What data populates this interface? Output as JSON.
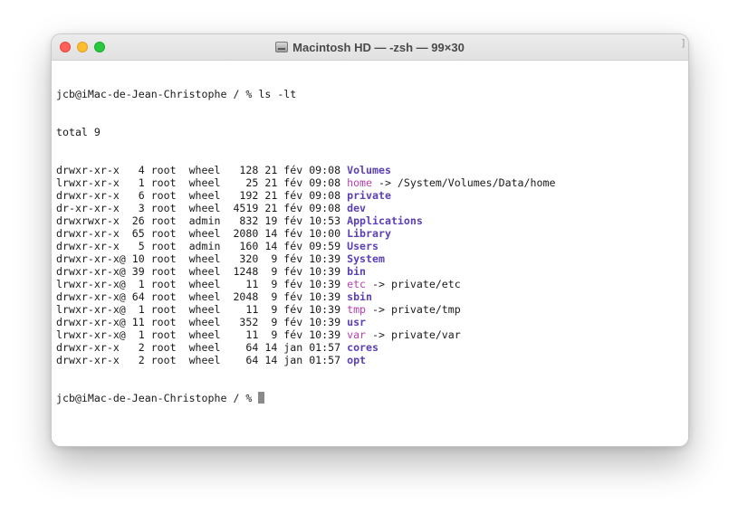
{
  "window": {
    "title": "Macintosh HD — -zsh — 99×30",
    "scroll_mark": "]"
  },
  "terminal": {
    "prompt": "jcb@iMac-de-Jean-Christophe / % ",
    "command": "ls -lt",
    "total": "total 9",
    "rows": [
      {
        "meta": "drwxr-xr-x   4 root  wheel   128 21 fév 09:08 ",
        "name": "Volumes",
        "kind": "dir",
        "target": ""
      },
      {
        "meta": "lrwxr-xr-x   1 root  wheel    25 21 fév 09:08 ",
        "name": "home",
        "kind": "link",
        "target": " -> /System/Volumes/Data/home"
      },
      {
        "meta": "drwxr-xr-x   6 root  wheel   192 21 fév 09:08 ",
        "name": "private",
        "kind": "dir",
        "target": ""
      },
      {
        "meta": "dr-xr-xr-x   3 root  wheel  4519 21 fév 09:08 ",
        "name": "dev",
        "kind": "dir",
        "target": ""
      },
      {
        "meta": "drwxrwxr-x  26 root  admin   832 19 fév 10:53 ",
        "name": "Applications",
        "kind": "dir",
        "target": ""
      },
      {
        "meta": "drwxr-xr-x  65 root  wheel  2080 14 fév 10:00 ",
        "name": "Library",
        "kind": "dir",
        "target": ""
      },
      {
        "meta": "drwxr-xr-x   5 root  admin   160 14 fév 09:59 ",
        "name": "Users",
        "kind": "dir",
        "target": ""
      },
      {
        "meta": "drwxr-xr-x@ 10 root  wheel   320  9 fév 10:39 ",
        "name": "System",
        "kind": "dir",
        "target": ""
      },
      {
        "meta": "drwxr-xr-x@ 39 root  wheel  1248  9 fév 10:39 ",
        "name": "bin",
        "kind": "dir",
        "target": ""
      },
      {
        "meta": "lrwxr-xr-x@  1 root  wheel    11  9 fév 10:39 ",
        "name": "etc",
        "kind": "link",
        "target": " -> private/etc"
      },
      {
        "meta": "drwxr-xr-x@ 64 root  wheel  2048  9 fév 10:39 ",
        "name": "sbin",
        "kind": "dir",
        "target": ""
      },
      {
        "meta": "lrwxr-xr-x@  1 root  wheel    11  9 fév 10:39 ",
        "name": "tmp",
        "kind": "link",
        "target": " -> private/tmp"
      },
      {
        "meta": "drwxr-xr-x@ 11 root  wheel   352  9 fév 10:39 ",
        "name": "usr",
        "kind": "dir",
        "target": ""
      },
      {
        "meta": "lrwxr-xr-x@  1 root  wheel    11  9 fév 10:39 ",
        "name": "var",
        "kind": "link",
        "target": " -> private/var"
      },
      {
        "meta": "drwxr-xr-x   2 root  wheel    64 14 jan 01:57 ",
        "name": "cores",
        "kind": "dir",
        "target": ""
      },
      {
        "meta": "drwxr-xr-x   2 root  wheel    64 14 jan 01:57 ",
        "name": "opt",
        "kind": "dir",
        "target": ""
      }
    ],
    "final_prompt": "jcb@iMac-de-Jean-Christophe / % "
  },
  "colors": {
    "directory": "#5b3fb5",
    "symlink": "#b53fb0",
    "close": "#fe5f57",
    "minimize": "#febc2e",
    "maximize": "#28c840"
  },
  "icons": {
    "title_icon": "hard-disk-icon"
  }
}
